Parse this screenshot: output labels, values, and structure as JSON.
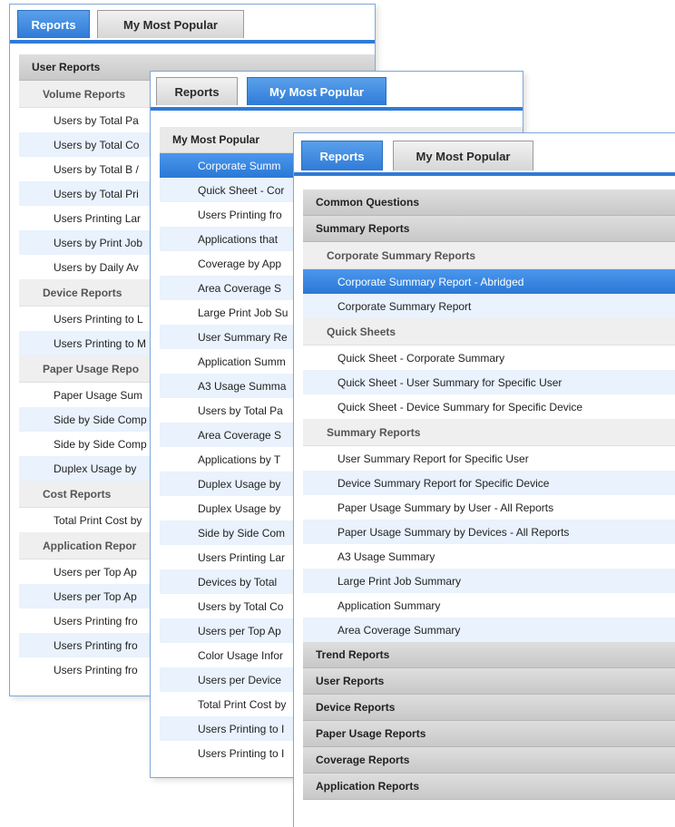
{
  "panel_back": {
    "tabs": [
      "Reports",
      "My Most Popular"
    ],
    "active_tab": 0,
    "rows": [
      {
        "type": "section",
        "label": "User Reports"
      },
      {
        "type": "sub",
        "label": "Volume Reports"
      },
      {
        "type": "item",
        "label": "Users by Total Pa"
      },
      {
        "type": "item",
        "label": "Users by Total Co"
      },
      {
        "type": "item",
        "label": "Users by Total B /"
      },
      {
        "type": "item",
        "label": "Users by Total Pri"
      },
      {
        "type": "item",
        "label": "Users Printing Lar"
      },
      {
        "type": "item",
        "label": "Users by Print Job"
      },
      {
        "type": "item",
        "label": "Users by Daily Av"
      },
      {
        "type": "sub",
        "label": "Device Reports"
      },
      {
        "type": "item",
        "label": "Users Printing to L"
      },
      {
        "type": "item",
        "label": "Users Printing to M"
      },
      {
        "type": "sub",
        "label": "Paper Usage Repo"
      },
      {
        "type": "item",
        "label": "Paper Usage Sum"
      },
      {
        "type": "item",
        "label": "Side by Side Comp"
      },
      {
        "type": "item",
        "label": "Side by Side Comp"
      },
      {
        "type": "item",
        "label": "Duplex Usage by"
      },
      {
        "type": "sub",
        "label": "Cost Reports"
      },
      {
        "type": "item",
        "label": "Total Print Cost by"
      },
      {
        "type": "sub",
        "label": "Application Repor"
      },
      {
        "type": "item",
        "label": "Users per Top Ap"
      },
      {
        "type": "item",
        "label": "Users per Top Ap"
      },
      {
        "type": "item",
        "label": "Users Printing fro"
      },
      {
        "type": "item",
        "label": "Users Printing fro"
      },
      {
        "type": "item",
        "label": "Users Printing fro"
      }
    ]
  },
  "panel_middle": {
    "tabs": [
      "Reports",
      "My Most Popular"
    ],
    "active_tab": 1,
    "rows": [
      {
        "type": "section",
        "label": "My Most Popular"
      },
      {
        "type": "item",
        "label": "Corporate Summ",
        "selected": true
      },
      {
        "type": "item",
        "label": "Quick Sheet - Cor"
      },
      {
        "type": "item",
        "label": "Users Printing fro"
      },
      {
        "type": "item",
        "label": "Applications that"
      },
      {
        "type": "item",
        "label": "Coverage by App"
      },
      {
        "type": "item",
        "label": "Area Coverage S"
      },
      {
        "type": "item",
        "label": "Large Print Job Su"
      },
      {
        "type": "item",
        "label": "User Summary Re"
      },
      {
        "type": "item",
        "label": "Application Summ"
      },
      {
        "type": "item",
        "label": "A3 Usage Summa"
      },
      {
        "type": "item",
        "label": "Users by Total Pa"
      },
      {
        "type": "item",
        "label": "Area Coverage S"
      },
      {
        "type": "item",
        "label": "Applications by T"
      },
      {
        "type": "item",
        "label": "Duplex Usage by"
      },
      {
        "type": "item",
        "label": "Duplex Usage by"
      },
      {
        "type": "item",
        "label": "Side by Side Com"
      },
      {
        "type": "item",
        "label": "Users Printing Lar"
      },
      {
        "type": "item",
        "label": "Devices by Total"
      },
      {
        "type": "item",
        "label": "Users by Total Co"
      },
      {
        "type": "item",
        "label": "Users per Top Ap"
      },
      {
        "type": "item",
        "label": "Color Usage Infor"
      },
      {
        "type": "item",
        "label": "Users per Device"
      },
      {
        "type": "item",
        "label": "Total Print Cost by"
      },
      {
        "type": "item",
        "label": "Users Printing to I"
      },
      {
        "type": "item",
        "label": "Users Printing to I"
      }
    ]
  },
  "panel_front": {
    "tabs": [
      "Reports",
      "My Most Popular"
    ],
    "active_tab": 0,
    "rows": [
      {
        "type": "section",
        "label": "Common Questions"
      },
      {
        "type": "section",
        "label": "Summary Reports"
      },
      {
        "type": "sub",
        "label": "Corporate Summary Reports"
      },
      {
        "type": "item",
        "label": "Corporate Summary Report - Abridged",
        "selected": true
      },
      {
        "type": "item",
        "label": "Corporate Summary Report"
      },
      {
        "type": "sub",
        "label": "Quick Sheets"
      },
      {
        "type": "item",
        "label": "Quick Sheet - Corporate Summary"
      },
      {
        "type": "item",
        "label": "Quick Sheet - User Summary for Specific User"
      },
      {
        "type": "item",
        "label": "Quick Sheet - Device Summary for Specific Device"
      },
      {
        "type": "sub",
        "label": "Summary Reports"
      },
      {
        "type": "item",
        "label": "User Summary Report for Specific User"
      },
      {
        "type": "item",
        "label": "Device Summary Report for Specific Device"
      },
      {
        "type": "item",
        "label": "Paper Usage Summary by User - All Reports"
      },
      {
        "type": "item",
        "label": "Paper Usage Summary by Devices - All Reports"
      },
      {
        "type": "item",
        "label": "A3 Usage Summary"
      },
      {
        "type": "item",
        "label": "Large Print Job Summary"
      },
      {
        "type": "item",
        "label": "Application Summary"
      },
      {
        "type": "item",
        "label": "Area Coverage Summary"
      },
      {
        "type": "section",
        "label": "Trend Reports"
      },
      {
        "type": "section",
        "label": "User Reports"
      },
      {
        "type": "section",
        "label": "Device Reports"
      },
      {
        "type": "section",
        "label": "Paper Usage Reports"
      },
      {
        "type": "section",
        "label": "Coverage Reports"
      },
      {
        "type": "section",
        "label": "Application Reports"
      }
    ]
  },
  "colors": {
    "accent": "#2f7bd8",
    "selected_row": "#3a8ae2",
    "alt_row": "#e9f2fd",
    "section_bg": "#d2d2d2"
  }
}
